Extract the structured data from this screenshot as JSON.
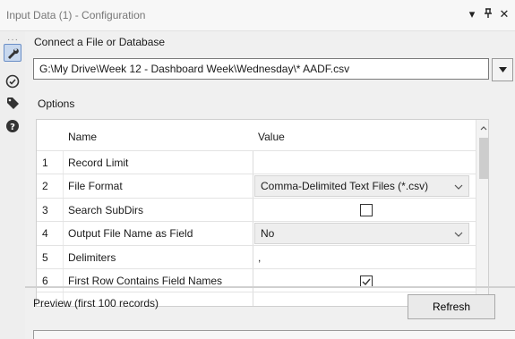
{
  "window": {
    "title": "Input Data (1) - Configuration",
    "controls": {
      "menu": "▾",
      "pin": "⊥",
      "close": "✕"
    }
  },
  "sidebar": {
    "icons": [
      "wrench-icon",
      "target-icon",
      "tag-icon",
      "help-icon"
    ],
    "active": "wrench-icon"
  },
  "connect": {
    "label": "Connect a File or Database",
    "path": "G:\\My Drive\\Week 12 - Dashboard Week\\Wednesday\\* AADF.csv"
  },
  "options": {
    "label": "Options",
    "columns": {
      "name": "Name",
      "value": "Value"
    },
    "rows": [
      {
        "num": "1",
        "name": "Record Limit",
        "value": ""
      },
      {
        "num": "2",
        "name": "File Format",
        "value": "Comma-Delimited Text Files (*.csv)"
      },
      {
        "num": "3",
        "name": "Search SubDirs",
        "value": "",
        "checked": false
      },
      {
        "num": "4",
        "name": "Output File Name as Field",
        "value": "No"
      },
      {
        "num": "5",
        "name": "Delimiters",
        "value": ","
      },
      {
        "num": "6",
        "name": "First Row Contains Field Names",
        "value": "",
        "checked": true
      }
    ]
  },
  "preview": {
    "label": "Preview (first 100 records)",
    "refresh_label": "Refresh"
  },
  "colors": {
    "accent": "#6b8fc7",
    "active_bg": "#c8d8ee",
    "border": "#7a7a7a"
  }
}
